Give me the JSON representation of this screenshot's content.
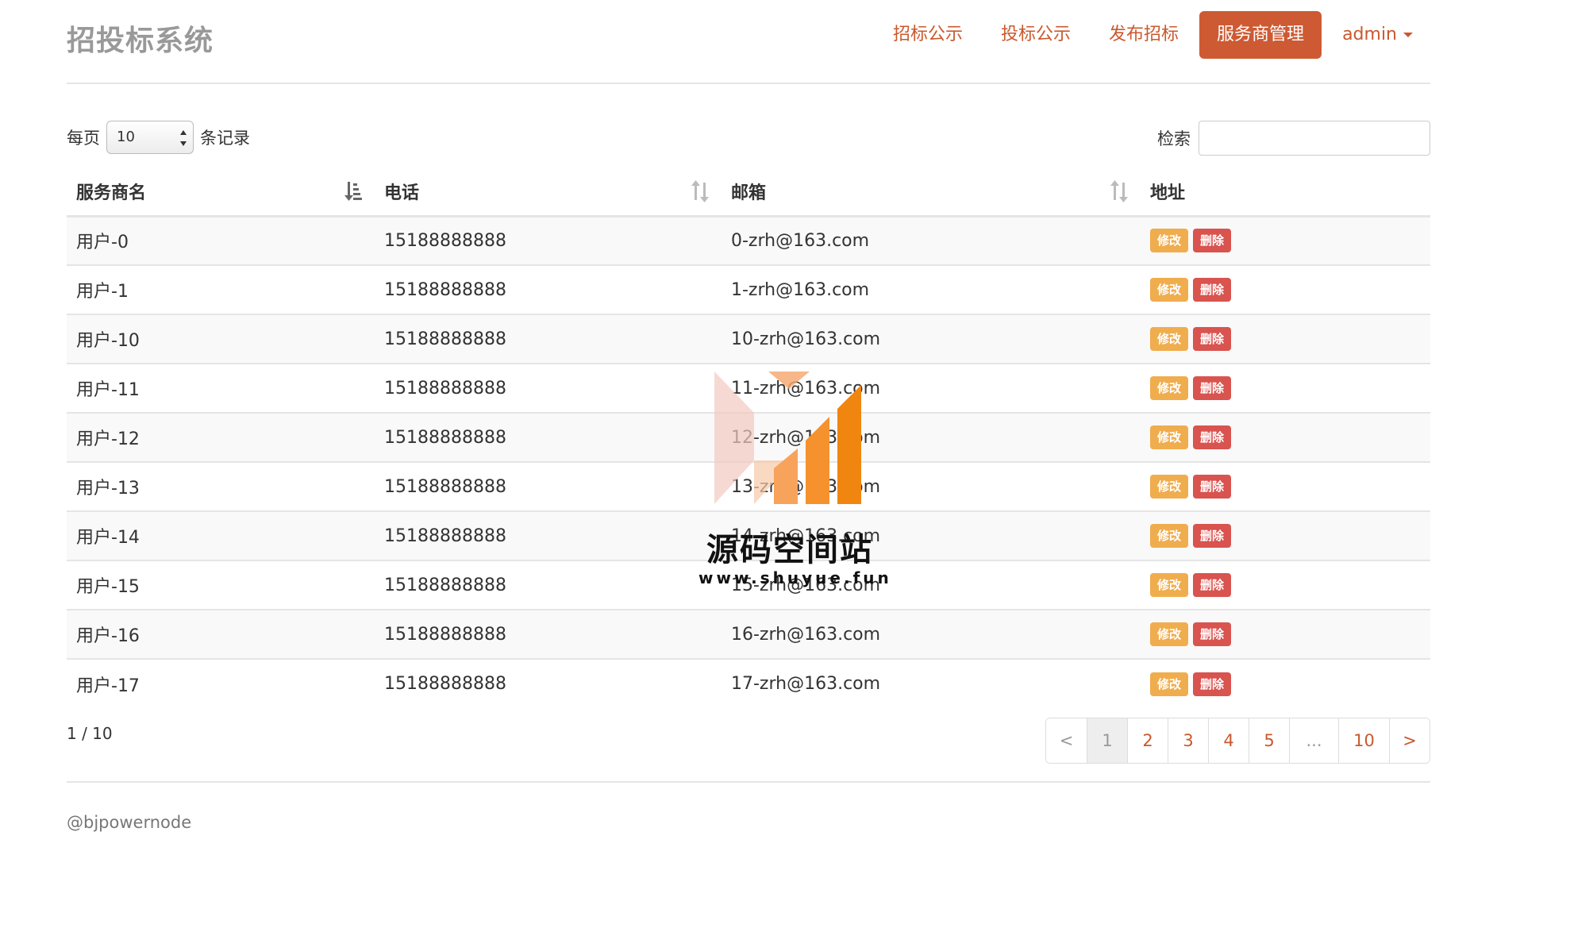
{
  "header": {
    "brand": "招投标系统",
    "nav": [
      {
        "label": "招标公示"
      },
      {
        "label": "投标公示"
      },
      {
        "label": "发布招标"
      },
      {
        "label": "服务商管理"
      },
      {
        "label": "admin"
      }
    ]
  },
  "controls": {
    "length_prefix": "每页",
    "length_value": "10",
    "length_suffix": "条记录",
    "search_label": "检索",
    "search_value": ""
  },
  "table": {
    "columns": [
      "服务商名",
      "电话",
      "邮箱",
      "地址"
    ],
    "edit_label": "修改",
    "delete_label": "删除",
    "rows": [
      {
        "name": "用户-0",
        "phone": "15188888888",
        "email": "0-zrh@163.com"
      },
      {
        "name": "用户-1",
        "phone": "15188888888",
        "email": "1-zrh@163.com"
      },
      {
        "name": "用户-10",
        "phone": "15188888888",
        "email": "10-zrh@163.com"
      },
      {
        "name": "用户-11",
        "phone": "15188888888",
        "email": "11-zrh@163.com"
      },
      {
        "name": "用户-12",
        "phone": "15188888888",
        "email": "12-zrh@163.com"
      },
      {
        "name": "用户-13",
        "phone": "15188888888",
        "email": "13-zrh@163.com"
      },
      {
        "name": "用户-14",
        "phone": "15188888888",
        "email": "14-zrh@163.com"
      },
      {
        "name": "用户-15",
        "phone": "15188888888",
        "email": "15-zrh@163.com"
      },
      {
        "name": "用户-16",
        "phone": "15188888888",
        "email": "16-zrh@163.com"
      },
      {
        "name": "用户-17",
        "phone": "15188888888",
        "email": "17-zrh@163.com"
      }
    ]
  },
  "pagination": {
    "info": "1 / 10",
    "pages": [
      "<",
      "1",
      "2",
      "3",
      "4",
      "5",
      "...",
      "10",
      ">"
    ]
  },
  "footer": {
    "copyright": "@bjpowernode"
  },
  "watermark": {
    "text": "源码空间站",
    "url": "www.shuyue.fun"
  },
  "colors": {
    "accent": "#cd5a33",
    "edit": "#f0ad4e",
    "delete": "#d9534f"
  }
}
